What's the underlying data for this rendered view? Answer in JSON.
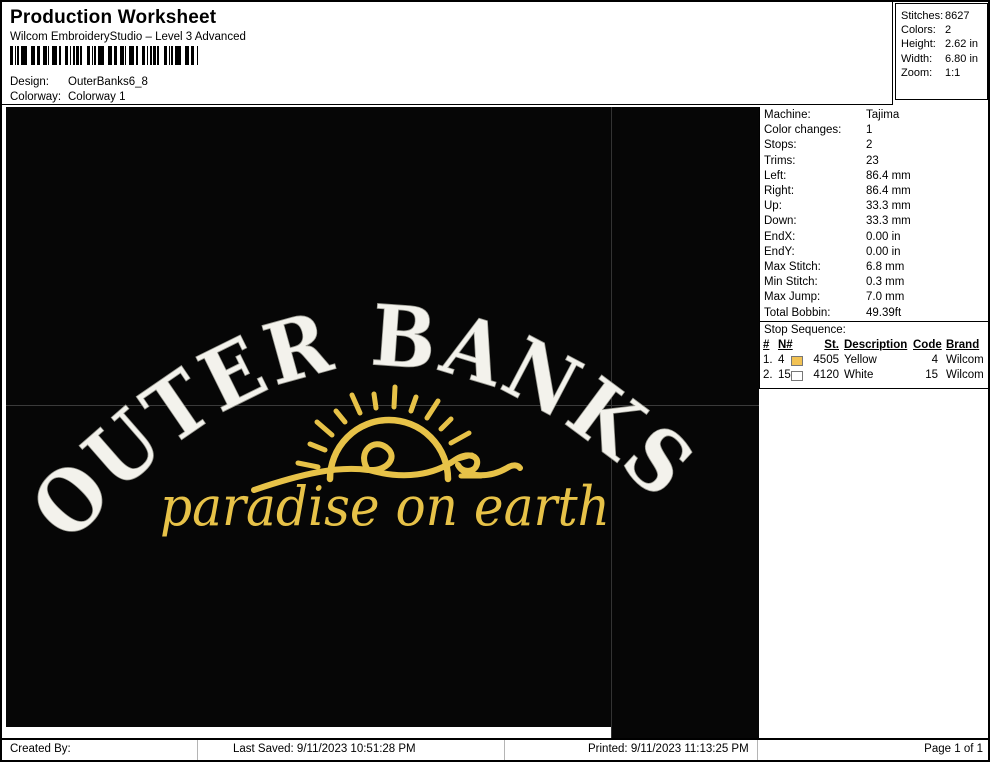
{
  "header": {
    "title": "Production Worksheet",
    "subtitle": "Wilcom EmbroideryStudio – Level 3 Advanced",
    "design_label": "Design:",
    "design_value": "OuterBanks6_8",
    "colorway_label": "Colorway:",
    "colorway_value": "Colorway 1"
  },
  "summary": {
    "rows": [
      {
        "label": "Stitches:",
        "value": "8627"
      },
      {
        "label": "Colors:",
        "value": "2"
      },
      {
        "label": "Height:",
        "value": "2.62 in"
      },
      {
        "label": "Width:",
        "value": "6.80 in"
      },
      {
        "label": "Zoom:",
        "value": "1:1"
      }
    ]
  },
  "machine_info": {
    "rows": [
      {
        "label": "Machine:",
        "value": "Tajima"
      },
      {
        "label": "Color changes:",
        "value": "1"
      },
      {
        "label": "Stops:",
        "value": "2"
      },
      {
        "label": "Trims:",
        "value": "23"
      },
      {
        "label": "Left:",
        "value": "86.4 mm"
      },
      {
        "label": "Right:",
        "value": "86.4 mm"
      },
      {
        "label": "Up:",
        "value": "33.3 mm"
      },
      {
        "label": "Down:",
        "value": "33.3 mm"
      },
      {
        "label": "EndX:",
        "value": "0.00 in"
      },
      {
        "label": "EndY:",
        "value": "0.00 in"
      },
      {
        "label": "Max Stitch:",
        "value": "6.8 mm"
      },
      {
        "label": "Min Stitch:",
        "value": "0.3 mm"
      },
      {
        "label": "Max Jump:",
        "value": "7.0 mm"
      },
      {
        "label": "Total Bobbin:",
        "value": "49.39ft"
      }
    ]
  },
  "stop_sequence": {
    "title": "Stop Sequence:",
    "columns": {
      "num": "#",
      "n": "N#",
      "st": "St.",
      "description": "Description",
      "code": "Code",
      "brand": "Brand"
    },
    "rows": [
      {
        "num": "1.",
        "n": "4",
        "swatch": "#f2c253",
        "st": "4505",
        "description": "Yellow",
        "code": "4",
        "brand": "Wilcom"
      },
      {
        "num": "2.",
        "n": "15",
        "swatch": "#ffffff",
        "st": "4120",
        "description": "White",
        "code": "15",
        "brand": "Wilcom"
      }
    ]
  },
  "design": {
    "arc_text": "OUTER BANKS",
    "script_text": "paradise on earth",
    "thread_yellow": "#e7c248",
    "thread_white": "#f3f2ec",
    "background": "#060606"
  },
  "footer": {
    "created_label": "Created By:",
    "last_saved": "Last Saved: 9/11/2023 10:51:28 PM",
    "printed": "Printed: 9/11/2023 11:13:25 PM",
    "page": "Page 1 of 1"
  }
}
